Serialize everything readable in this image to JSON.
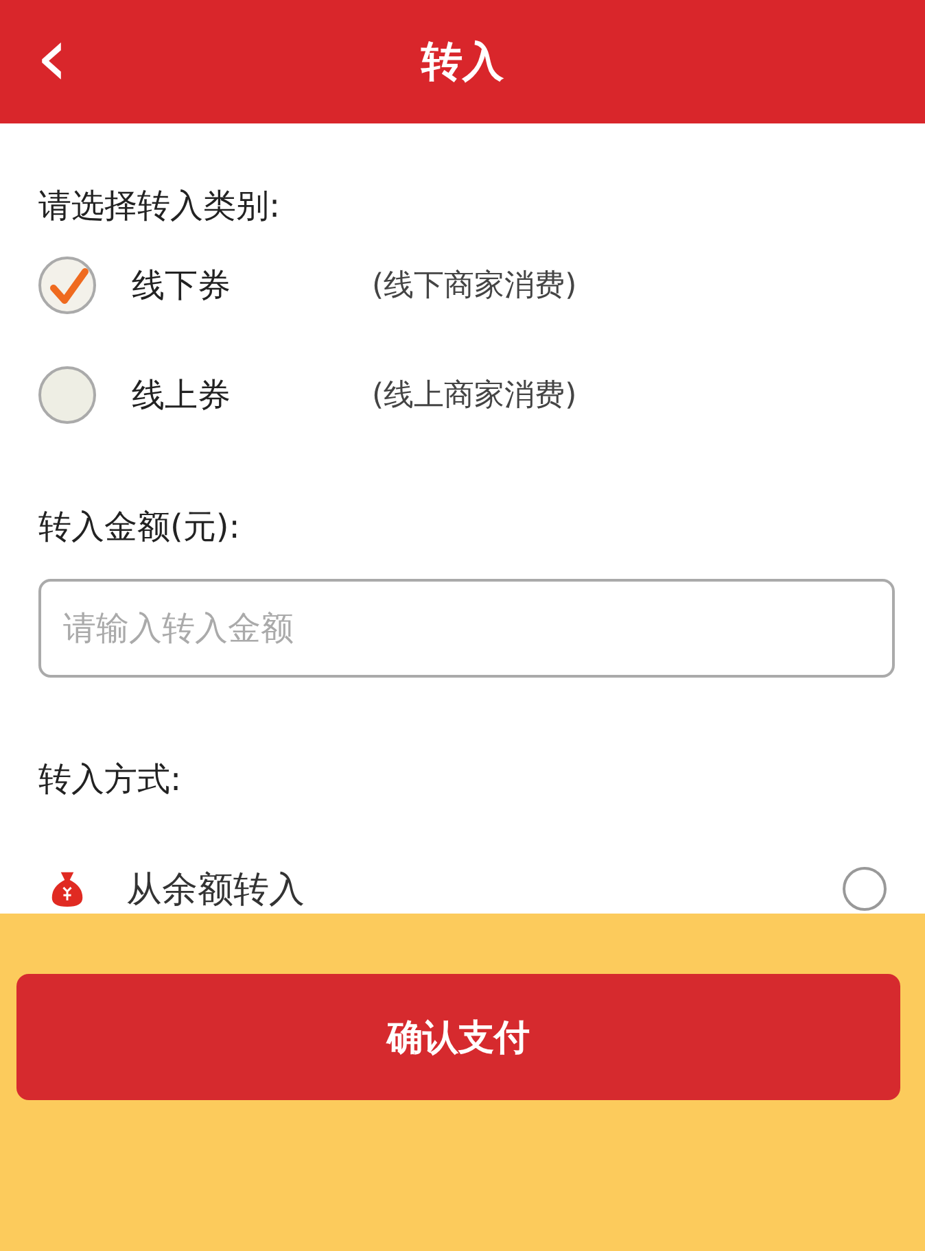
{
  "header": {
    "back": "‹",
    "title": "转入"
  },
  "category": {
    "label": "请选择转入类别:",
    "options": [
      {
        "name": "线下券",
        "note": "(线下商家消费)",
        "selected": true
      },
      {
        "name": "线上券",
        "note": "(线上商家消费)",
        "selected": false
      }
    ]
  },
  "amount": {
    "label": "转入金额(元):",
    "placeholder": "请输入转入金额"
  },
  "method": {
    "label": "转入方式:",
    "options": [
      {
        "name": "从余额转入",
        "selected": false
      }
    ]
  },
  "confirm_button": "确认支付"
}
